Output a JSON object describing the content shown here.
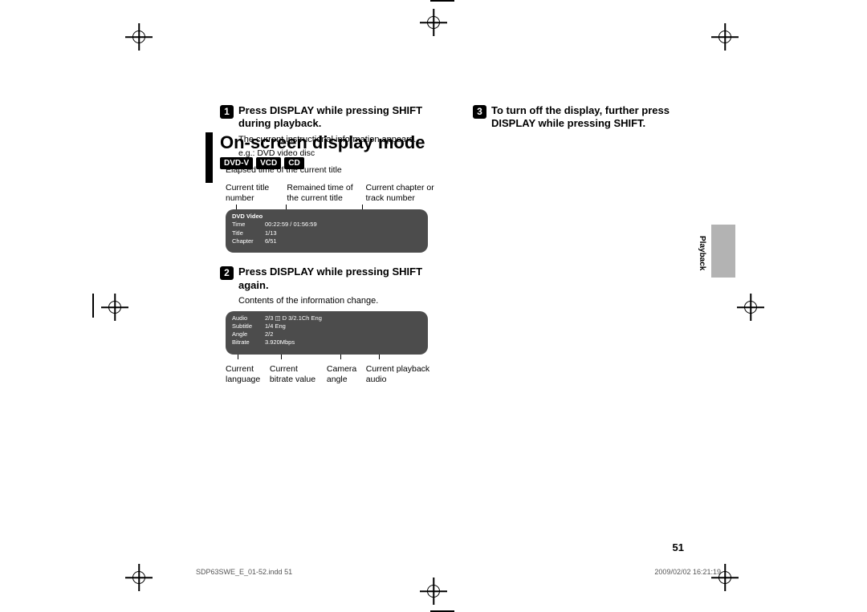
{
  "page": {
    "title": "On-screen display mode",
    "number": "51",
    "section_tab": "Playback"
  },
  "badges": [
    "DVD-V",
    "VCD",
    "CD"
  ],
  "steps": {
    "s1_title": "Press DISPLAY while pressing SHIFT during playback.",
    "s1_body": "The current instructional information appears.",
    "s1_eg": "e.g.: DVD video disc",
    "s2_title": "Press DISPLAY while pressing SHIFT again.",
    "s2_body": "Contents of the information change.",
    "s3_title": "To turn off the display, further press DISPLAY while pressing SHIFT."
  },
  "callouts1": {
    "elapsed": "Elapsed time of the current title",
    "a": "Current title number",
    "b": "Remained time of the current title",
    "c": "Current chapter or track number"
  },
  "osd1": [
    {
      "k": "DVD Video",
      "v": ""
    },
    {
      "k": "Time",
      "v": "00:22:59 / 01:56:59"
    },
    {
      "k": "Title",
      "v": "1/13"
    },
    {
      "k": "Chapter",
      "v": "6/51"
    }
  ],
  "osd2": [
    {
      "k": "Audio",
      "v": "2/3   ◫ D 3/2.1Ch Eng"
    },
    {
      "k": "Subtitle",
      "v": "1/4 Eng"
    },
    {
      "k": "Angle",
      "v": "2/2"
    },
    {
      "k": "Bitrate",
      "v": "3.920Mbps"
    }
  ],
  "callouts2": {
    "a": "Current language",
    "b": "Current bitrate value",
    "c": "Camera angle",
    "d": "Current playback audio"
  },
  "footer": {
    "left": "SDP63SWE_E_01-52.indd   51",
    "right": "2009/02/02   16:21:19"
  }
}
